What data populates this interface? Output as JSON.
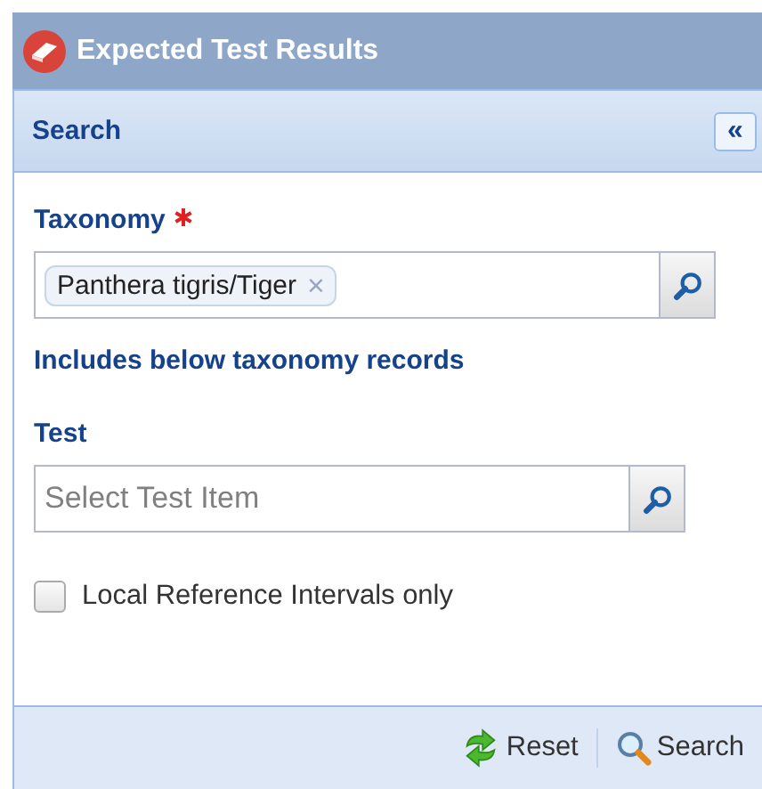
{
  "window": {
    "title": "Expected Test Results"
  },
  "search_panel": {
    "title": "Search",
    "collapse_button": "«"
  },
  "taxonomy": {
    "label": "Taxonomy",
    "required": true,
    "tags": [
      {
        "label": "Panthera tigris/Tiger",
        "remove": "×"
      }
    ],
    "note": "Includes below taxonomy records"
  },
  "test": {
    "label": "Test",
    "placeholder": "Select Test Item"
  },
  "local_only": {
    "label": "Local Reference Intervals only",
    "checked": false
  },
  "buttons": [
    {
      "kind": "reset",
      "label": "Reset"
    },
    {
      "kind": "search",
      "label": "Search"
    }
  ]
}
